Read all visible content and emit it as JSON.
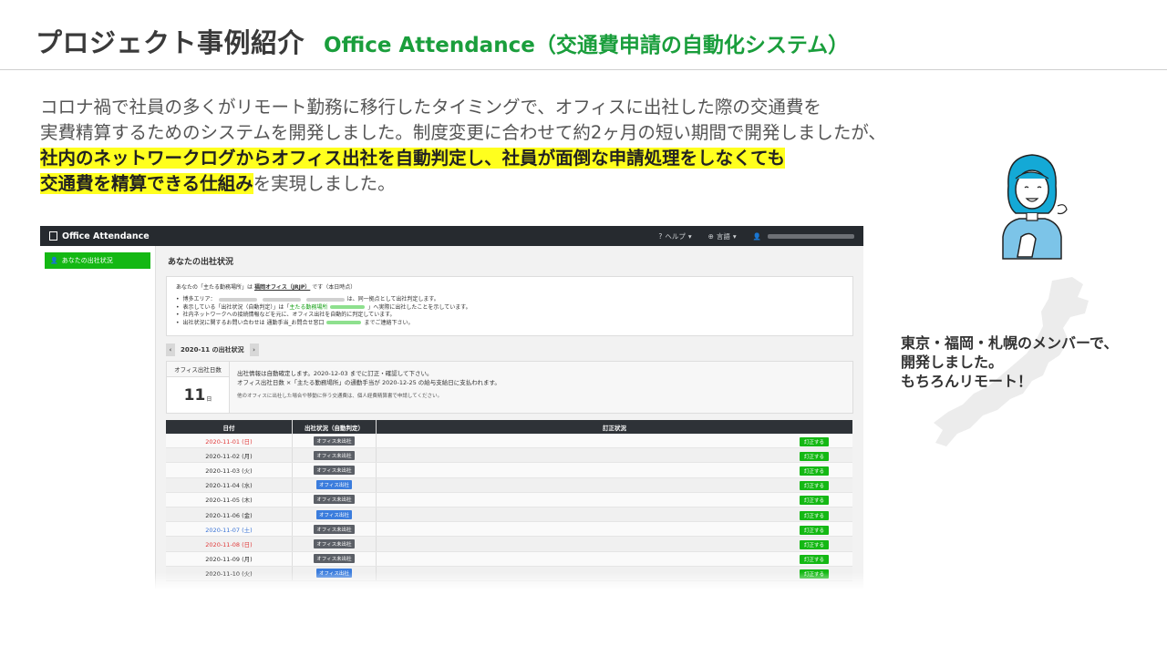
{
  "slide": {
    "title": "プロジェクト事例紹介",
    "subtitle": "Office Attendance（交通費申請の自動化システム）",
    "intro": {
      "line1": "コロナ禍で社員の多くがリモート勤務に移行したタイミングで、オフィスに出社した際の交通費を",
      "line2": "実費精算するためのシステムを開発しました。制度変更に合わせて約2ヶ月の短い期間で開発しましたが、",
      "line3_highlight": "社内のネットワークログからオフィス出社を自動判定し、社員が面倒な申請処理をしなくても",
      "line4_highlight": "交通費を精算できる仕組み",
      "line4_rest": "を実現しました。"
    },
    "note": {
      "line1": "東京・福岡・札幌のメンバーで、",
      "line2": "開発しました。",
      "line3": "もちろんリモート！"
    }
  },
  "app": {
    "brand": "Office Attendance",
    "nav": {
      "help": "ヘルプ",
      "language": "言語"
    },
    "sidebar": {
      "item_label": "あなたの出社状況"
    },
    "page_title": "あなたの出社状況",
    "info": {
      "main_prefix": "あなたの「主たる勤務場所」は",
      "main_place": "福岡オフィス（JRJP）",
      "main_suffix": "です（本日時点）",
      "b1_prefix": "博多エリア：",
      "b1_suffix": "は、同一拠点として出社判定します。",
      "b2_prefix": "表示している「出社状況（自動判定）」は「",
      "b2_mid": "主たる勤務場所",
      "b2_suffix": "」へ実際に出社したことを示しています。",
      "b3": "社内ネットワークへの接続情報などを元に、オフィス出社を自動的に判定しています。",
      "b4_prefix": "出社状況に関するお問い合わせは 通勤手当_お問合せ窓口",
      "b4_suffix": "までご連絡下さい。"
    },
    "month_label": "2020-11 の出社状況",
    "month_prev": "‹",
    "month_next": "›",
    "days": {
      "label": "オフィス出社日数",
      "value": "11",
      "unit": "日"
    },
    "summary": {
      "l1": "出社情報は自動確定します。2020-12-03 までに訂正・確認して下さい。",
      "l2": "オフィス出社日数 ×「主たる勤務場所」の通勤手当が 2020-12-25 の給与支給日に支払われます。",
      "l3": "他のオフィスに出社した場合や移動に伴う交通費は、個人経費精算書で申請してください。"
    },
    "table": {
      "headers": {
        "date": "日付",
        "status": "出社状況（自動判定）",
        "fix": "訂正状況"
      },
      "fix_button": "訂正する",
      "rows": [
        {
          "date": "2020-11-01 (日)",
          "status": "オフィス未出社",
          "kind": "sun"
        },
        {
          "date": "2020-11-02 (月)",
          "status": "オフィス未出社",
          "kind": "norm"
        },
        {
          "date": "2020-11-03 (火)",
          "status": "オフィス未出社",
          "kind": "norm"
        },
        {
          "date": "2020-11-04 (水)",
          "status": "オフィス出社",
          "kind": "norm"
        },
        {
          "date": "2020-11-05 (木)",
          "status": "オフィス未出社",
          "kind": "norm"
        },
        {
          "date": "2020-11-06 (金)",
          "status": "オフィス出社",
          "kind": "norm"
        },
        {
          "date": "2020-11-07 (土)",
          "status": "オフィス未出社",
          "kind": "sat"
        },
        {
          "date": "2020-11-08 (日)",
          "status": "オフィス未出社",
          "kind": "sun"
        },
        {
          "date": "2020-11-09 (月)",
          "status": "オフィス未出社",
          "kind": "norm"
        },
        {
          "date": "2020-11-10 (火)",
          "status": "オフィス出社",
          "kind": "norm"
        }
      ]
    }
  }
}
